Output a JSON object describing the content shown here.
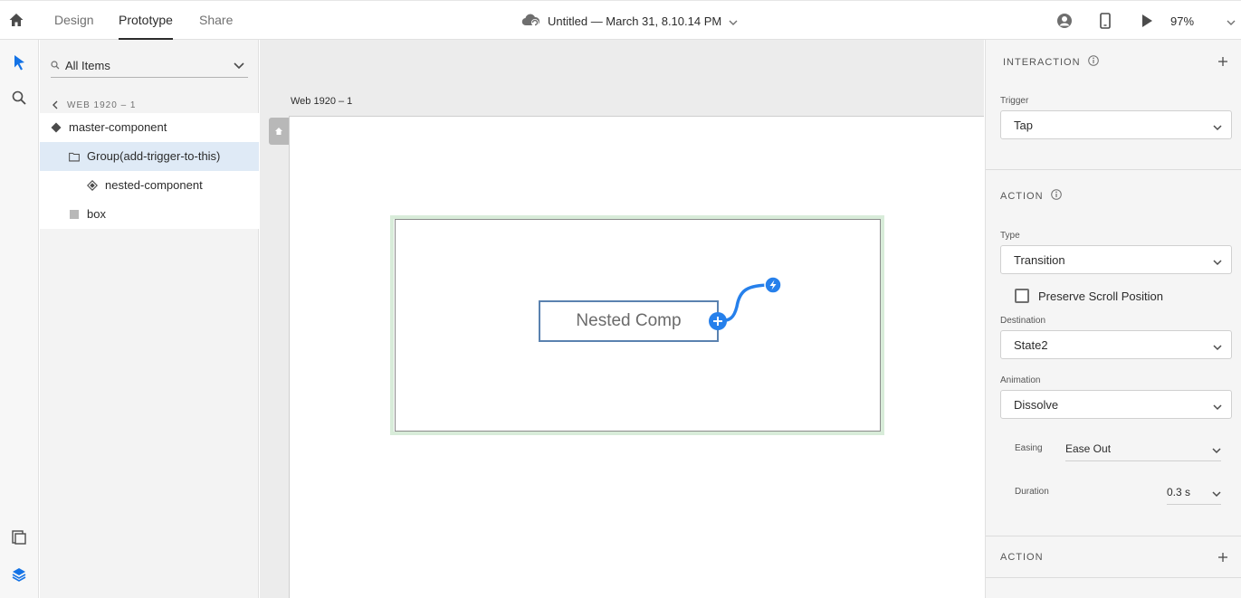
{
  "topbar": {
    "tabs": [
      {
        "label": "Design",
        "active": false
      },
      {
        "label": "Prototype",
        "active": true
      },
      {
        "label": "Share",
        "active": false
      }
    ],
    "doc_title": "Untitled — March 31, 8.10.14 PM",
    "zoom": "97%"
  },
  "layers": {
    "search_label": "All Items",
    "breadcrumb": "WEB 1920 – 1",
    "items": [
      {
        "label": "master-component",
        "icon": "component-icon"
      },
      {
        "label": "Group(add-trigger-to-this)",
        "icon": "folder-icon",
        "selected": true
      },
      {
        "label": "nested-component",
        "icon": "component-icon"
      },
      {
        "label": "box",
        "icon": "rectangle-icon"
      }
    ]
  },
  "canvas": {
    "artboard_label": "Web 1920 – 1",
    "nested_text": "Nested Comp"
  },
  "props": {
    "interaction_title": "INTERACTION",
    "trigger_label": "Trigger",
    "trigger_value": "Tap",
    "action_title": "ACTION",
    "type_label": "Type",
    "type_value": "Transition",
    "preserve_label": "Preserve Scroll Position",
    "destination_label": "Destination",
    "destination_value": "State2",
    "animation_label": "Animation",
    "animation_value": "Dissolve",
    "easing_label": "Easing",
    "easing_value": "Ease Out",
    "duration_label": "Duration",
    "duration_value": "0.3 s",
    "action2_title": "ACTION"
  },
  "colors": {
    "accent": "#1473e6",
    "selection": "#dfeaf6",
    "group_highlight": "#d8ecd9",
    "wire": "#2680eb"
  }
}
